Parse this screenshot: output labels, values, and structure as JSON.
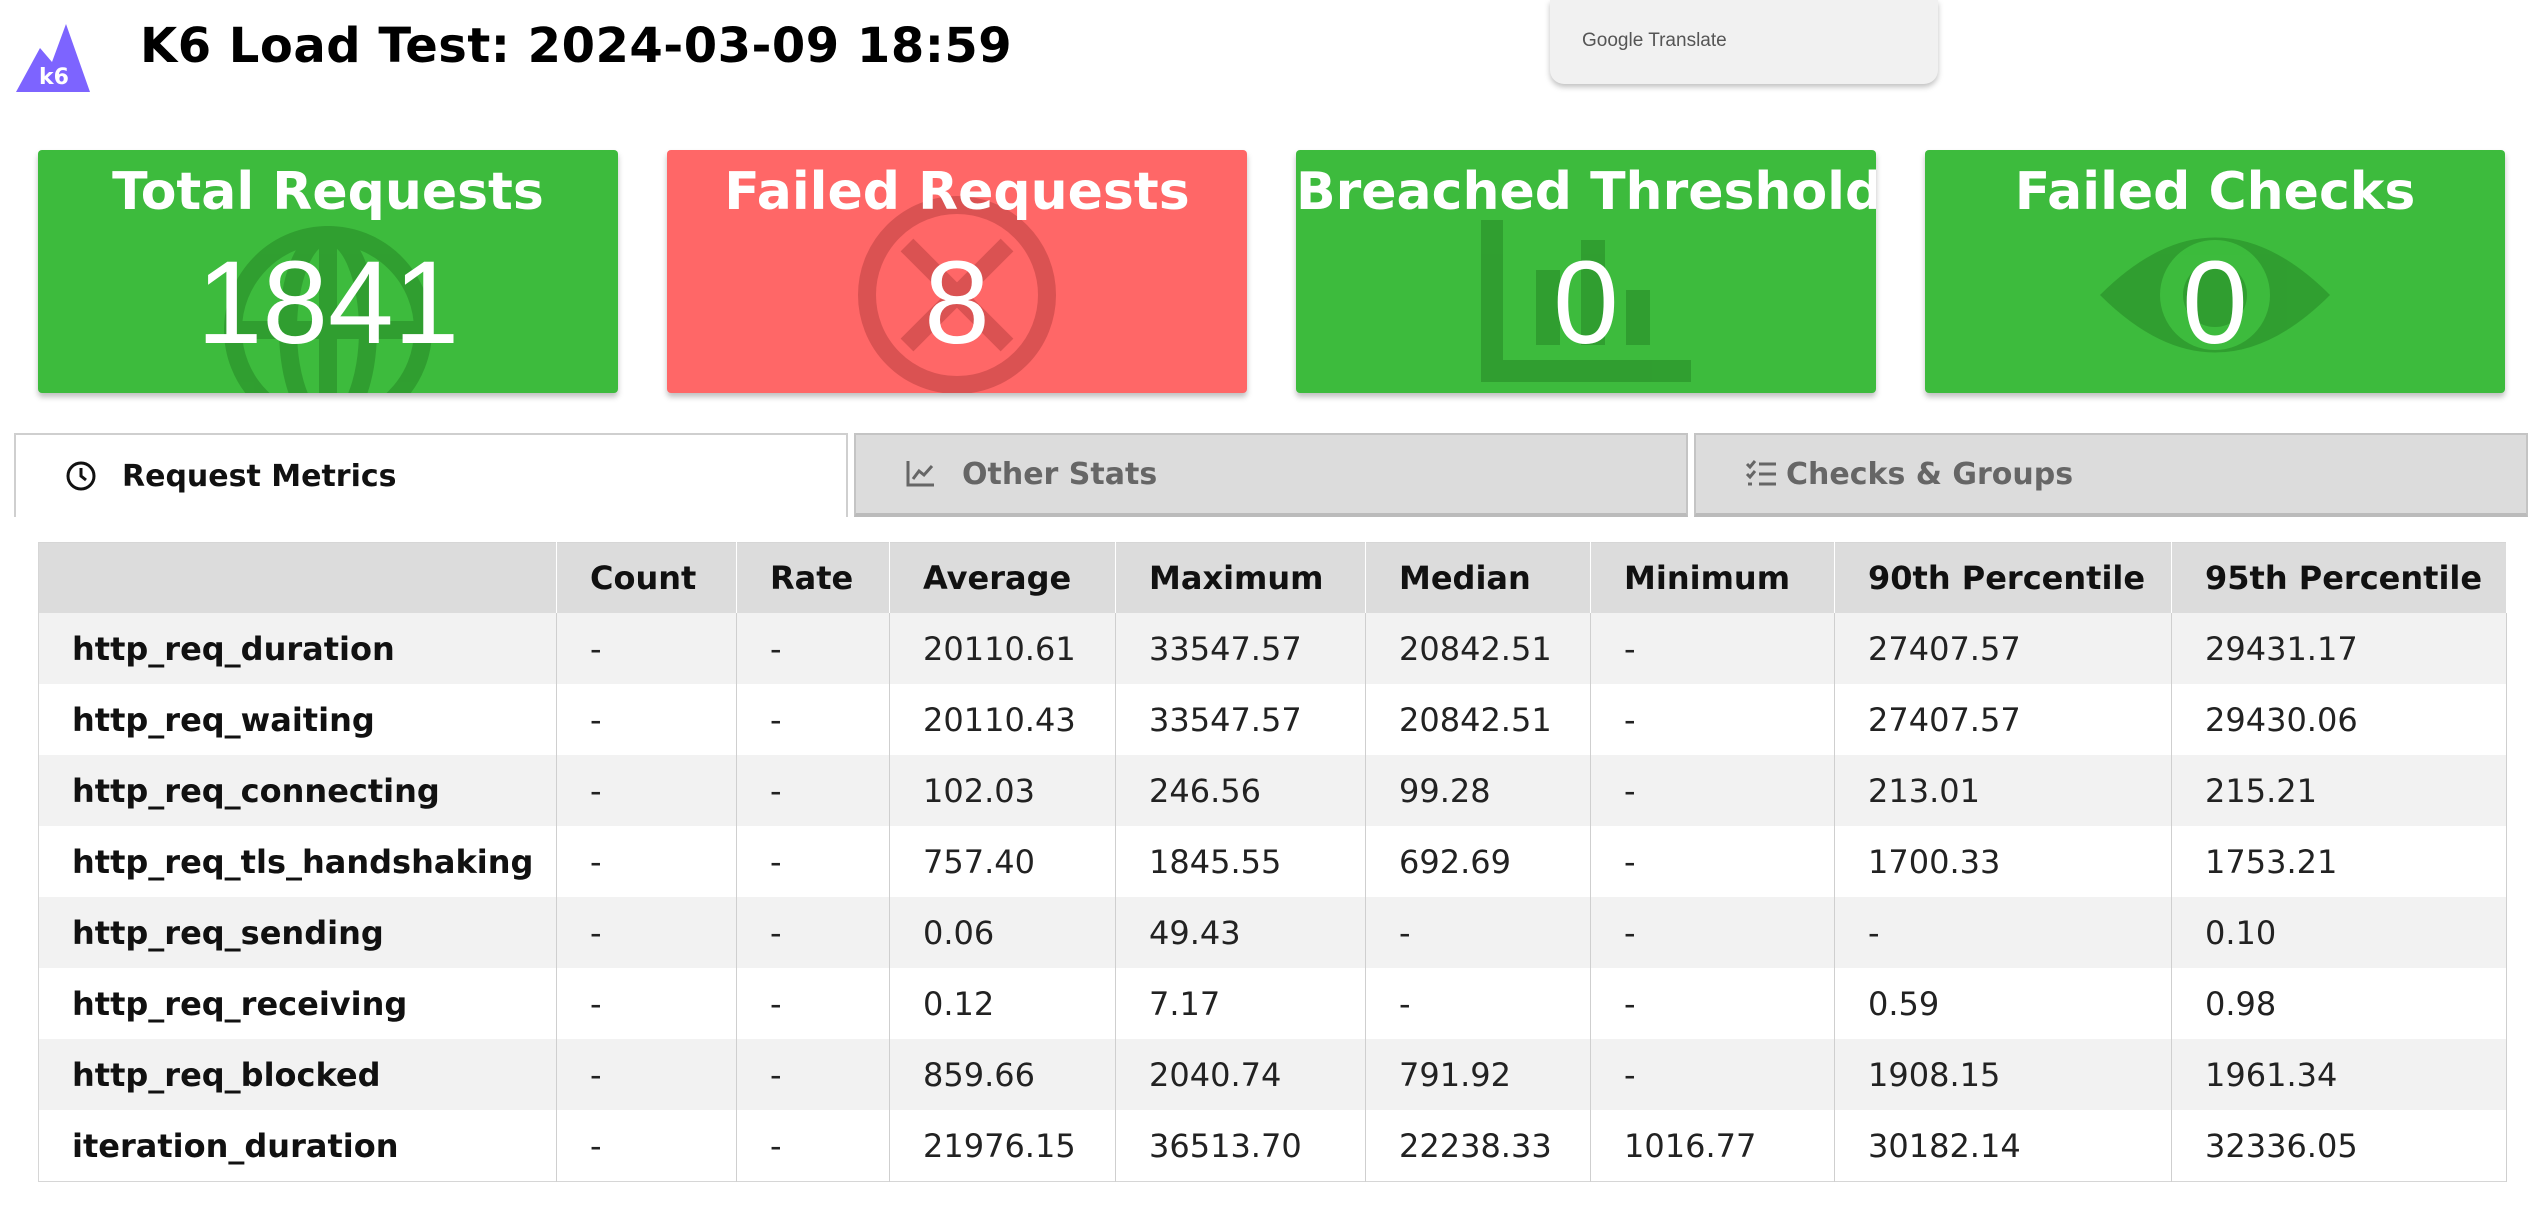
{
  "header": {
    "logo_text": "k6",
    "title": "K6 Load Test: 2024-03-09 18:59"
  },
  "translate_popup": {
    "label": "Google Translate"
  },
  "cards": [
    {
      "title": "Total Requests",
      "value": "1841",
      "icon": "globe-icon",
      "color": "#3dbb3d"
    },
    {
      "title": "Failed Requests",
      "value": "8",
      "icon": "x-circle-icon",
      "color": "#ff6767"
    },
    {
      "title": "Breached Thresholds",
      "value": "0",
      "icon": "bar-chart-icon",
      "color": "#3dbb3d"
    },
    {
      "title": "Failed Checks",
      "value": "0",
      "icon": "eye-icon",
      "color": "#3dbb3d"
    }
  ],
  "tabs": [
    {
      "label": "Request Metrics",
      "icon": "clock-icon",
      "active": true
    },
    {
      "label": "Other Stats",
      "icon": "line-chart-icon",
      "active": false
    },
    {
      "label": "Checks & Groups",
      "icon": "checklist-icon",
      "active": false
    }
  ],
  "table": {
    "columns": [
      "",
      "Count",
      "Rate",
      "Average",
      "Maximum",
      "Median",
      "Minimum",
      "90th Percentile",
      "95th Percentile"
    ],
    "rows": [
      [
        "http_req_duration",
        "-",
        "-",
        "20110.61",
        "33547.57",
        "20842.51",
        "-",
        "27407.57",
        "29431.17"
      ],
      [
        "http_req_waiting",
        "-",
        "-",
        "20110.43",
        "33547.57",
        "20842.51",
        "-",
        "27407.57",
        "29430.06"
      ],
      [
        "http_req_connecting",
        "-",
        "-",
        "102.03",
        "246.56",
        "99.28",
        "-",
        "213.01",
        "215.21"
      ],
      [
        "http_req_tls_handshaking",
        "-",
        "-",
        "757.40",
        "1845.55",
        "692.69",
        "-",
        "1700.33",
        "1753.21"
      ],
      [
        "http_req_sending",
        "-",
        "-",
        "0.06",
        "49.43",
        "-",
        "-",
        "-",
        "0.10"
      ],
      [
        "http_req_receiving",
        "-",
        "-",
        "0.12",
        "7.17",
        "-",
        "-",
        "0.59",
        "0.98"
      ],
      [
        "http_req_blocked",
        "-",
        "-",
        "859.66",
        "2040.74",
        "791.92",
        "-",
        "1908.15",
        "1961.34"
      ],
      [
        "iteration_duration",
        "-",
        "-",
        "21976.15",
        "36513.70",
        "22238.33",
        "1016.77",
        "30182.14",
        "32336.05"
      ]
    ]
  },
  "colors": {
    "success": "#3dbb3d",
    "danger": "#ff6767",
    "logo": "#7d64ff"
  }
}
